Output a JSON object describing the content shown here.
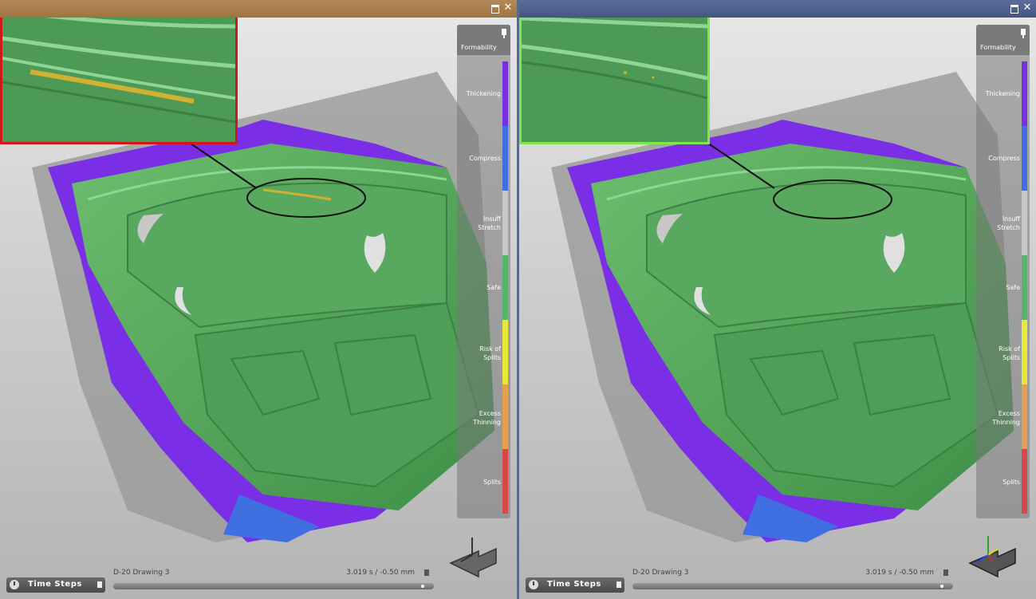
{
  "viewports": [
    {
      "id": "left",
      "accent": "#d01818",
      "titlebar_color": "#a67c4a",
      "legend": {
        "title": "Formability",
        "items": [
          {
            "label": "Thickening",
            "color": "#7a2ee6"
          },
          {
            "label": "Compress",
            "color": "#3f6fe0"
          },
          {
            "label": "Insuff\nStretch",
            "color": "#c8c8c8"
          },
          {
            "label": "Safe",
            "color": "#56b56a"
          },
          {
            "label": "Risk of\nSplits",
            "color": "#e8e83a"
          },
          {
            "label": "Excess\nThinning",
            "color": "#e2a050"
          },
          {
            "label": "Splits",
            "color": "#d84848"
          }
        ]
      },
      "footer": {
        "time_steps_label": "Time Steps",
        "stage_name": "D-20 Drawing 3",
        "time_readout": "3.019 s / -0.50 mm",
        "progress": 0.97
      }
    },
    {
      "id": "right",
      "accent": "#7ee84a",
      "titlebar_color": "#4a5c8a",
      "legend": {
        "title": "Formability",
        "items": [
          {
            "label": "Thickening",
            "color": "#7a2ee6"
          },
          {
            "label": "Compress",
            "color": "#3f6fe0"
          },
          {
            "label": "Insuff\nStretch",
            "color": "#c8c8c8"
          },
          {
            "label": "Safe",
            "color": "#56b56a"
          },
          {
            "label": "Risk of\nSplits",
            "color": "#e8e83a"
          },
          {
            "label": "Excess\nThinning",
            "color": "#e2a050"
          },
          {
            "label": "Splits",
            "color": "#d84848"
          }
        ]
      },
      "footer": {
        "time_steps_label": "Time Steps",
        "stage_name": "D-20 Drawing 3",
        "time_readout": "3.019 s / -0.50 mm",
        "progress": 0.97
      }
    }
  ],
  "icons": {
    "maximize": "maximize-icon",
    "close": "close-icon",
    "pin": "pin-icon",
    "clock": "clock-icon",
    "triad": "axis-triad-icon"
  },
  "window_close_glyph": "✕"
}
